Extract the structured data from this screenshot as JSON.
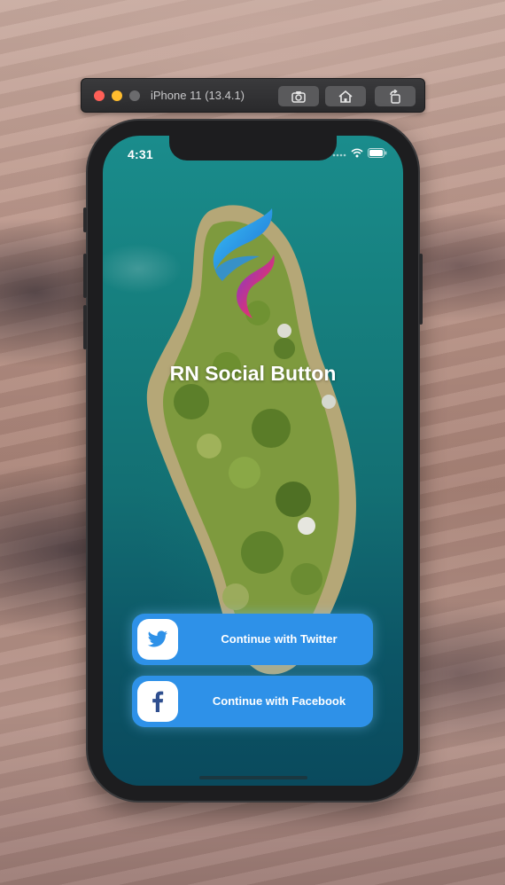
{
  "simulator": {
    "title": "iPhone 11 (13.4.1)",
    "buttons": [
      "screenshot-icon",
      "home-icon",
      "rotate-icon"
    ]
  },
  "status_bar": {
    "time": "4:31",
    "icons": [
      "signal-icon",
      "wifi-icon",
      "battery-icon"
    ]
  },
  "app": {
    "title": "RN Social Button",
    "logo": "app-logo"
  },
  "buttons": {
    "twitter": {
      "label": "Continue with Twitter",
      "icon": "twitter-icon",
      "color": "#2e91e8"
    },
    "facebook": {
      "label": "Continue with Facebook",
      "icon": "facebook-icon",
      "color": "#2e91e8"
    }
  },
  "colors": {
    "button_blue": "#2e91e8",
    "twitter_bird": "#2e91e8",
    "facebook_f": "#2f4f8f"
  }
}
